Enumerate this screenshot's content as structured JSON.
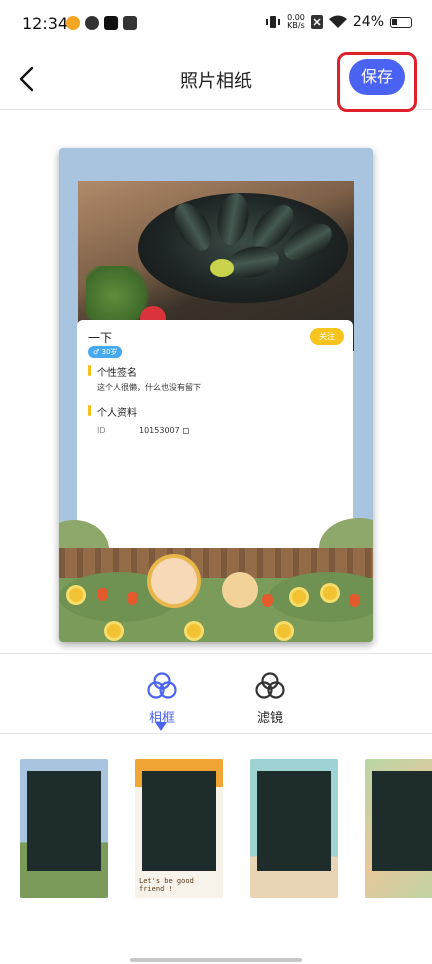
{
  "status_bar": {
    "time": "12:34",
    "net_speed_value": "0.00",
    "net_speed_unit": "KB/s",
    "battery": "24%"
  },
  "nav": {
    "title": "照片相纸",
    "save_label": "保存",
    "accent_color": "#4a63f2",
    "highlight_color": "#e0202a"
  },
  "preview": {
    "card": {
      "name": "一下",
      "follow_label": "关注",
      "age_badge": "♂ 30岁",
      "signature_heading": "个性签名",
      "signature_text": "这个人很懒，什么也没有留下",
      "profile_heading": "个人资料",
      "id_label": "ID",
      "id_value": "10153007"
    }
  },
  "tabs": [
    {
      "label": "相框",
      "active": true,
      "icon": "frame-icon"
    },
    {
      "label": "滤镜",
      "active": false,
      "icon": "filter-icon"
    }
  ],
  "frames": {
    "thumb2_caption": "Let's be good friend !"
  }
}
